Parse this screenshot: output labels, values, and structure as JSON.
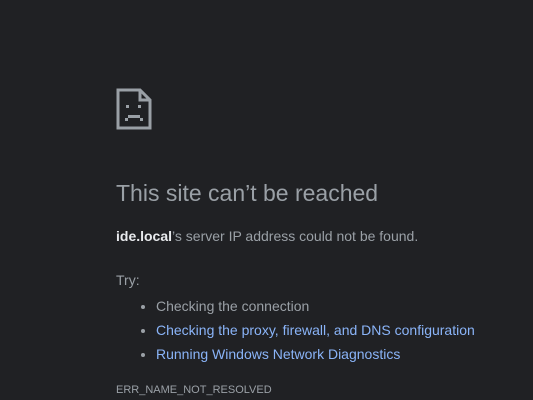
{
  "page": {
    "icon": "sad-page-icon",
    "title": "This site can’t be reached",
    "summary": {
      "host": "ide.local",
      "message": "’s server IP address could not be found."
    },
    "try_label": "Try:",
    "suggestions": [
      {
        "label": "Checking the connection",
        "link": false
      },
      {
        "label": "Checking the proxy, firewall, and DNS configuration",
        "link": true
      },
      {
        "label": "Running Windows Network Diagnostics",
        "link": true
      }
    ],
    "error_code": "ERR_NAME_NOT_RESOLVED"
  },
  "colors": {
    "background": "#202124",
    "text": "#9aa0a6",
    "host": "#e8eaed",
    "link": "#8ab4f8"
  }
}
